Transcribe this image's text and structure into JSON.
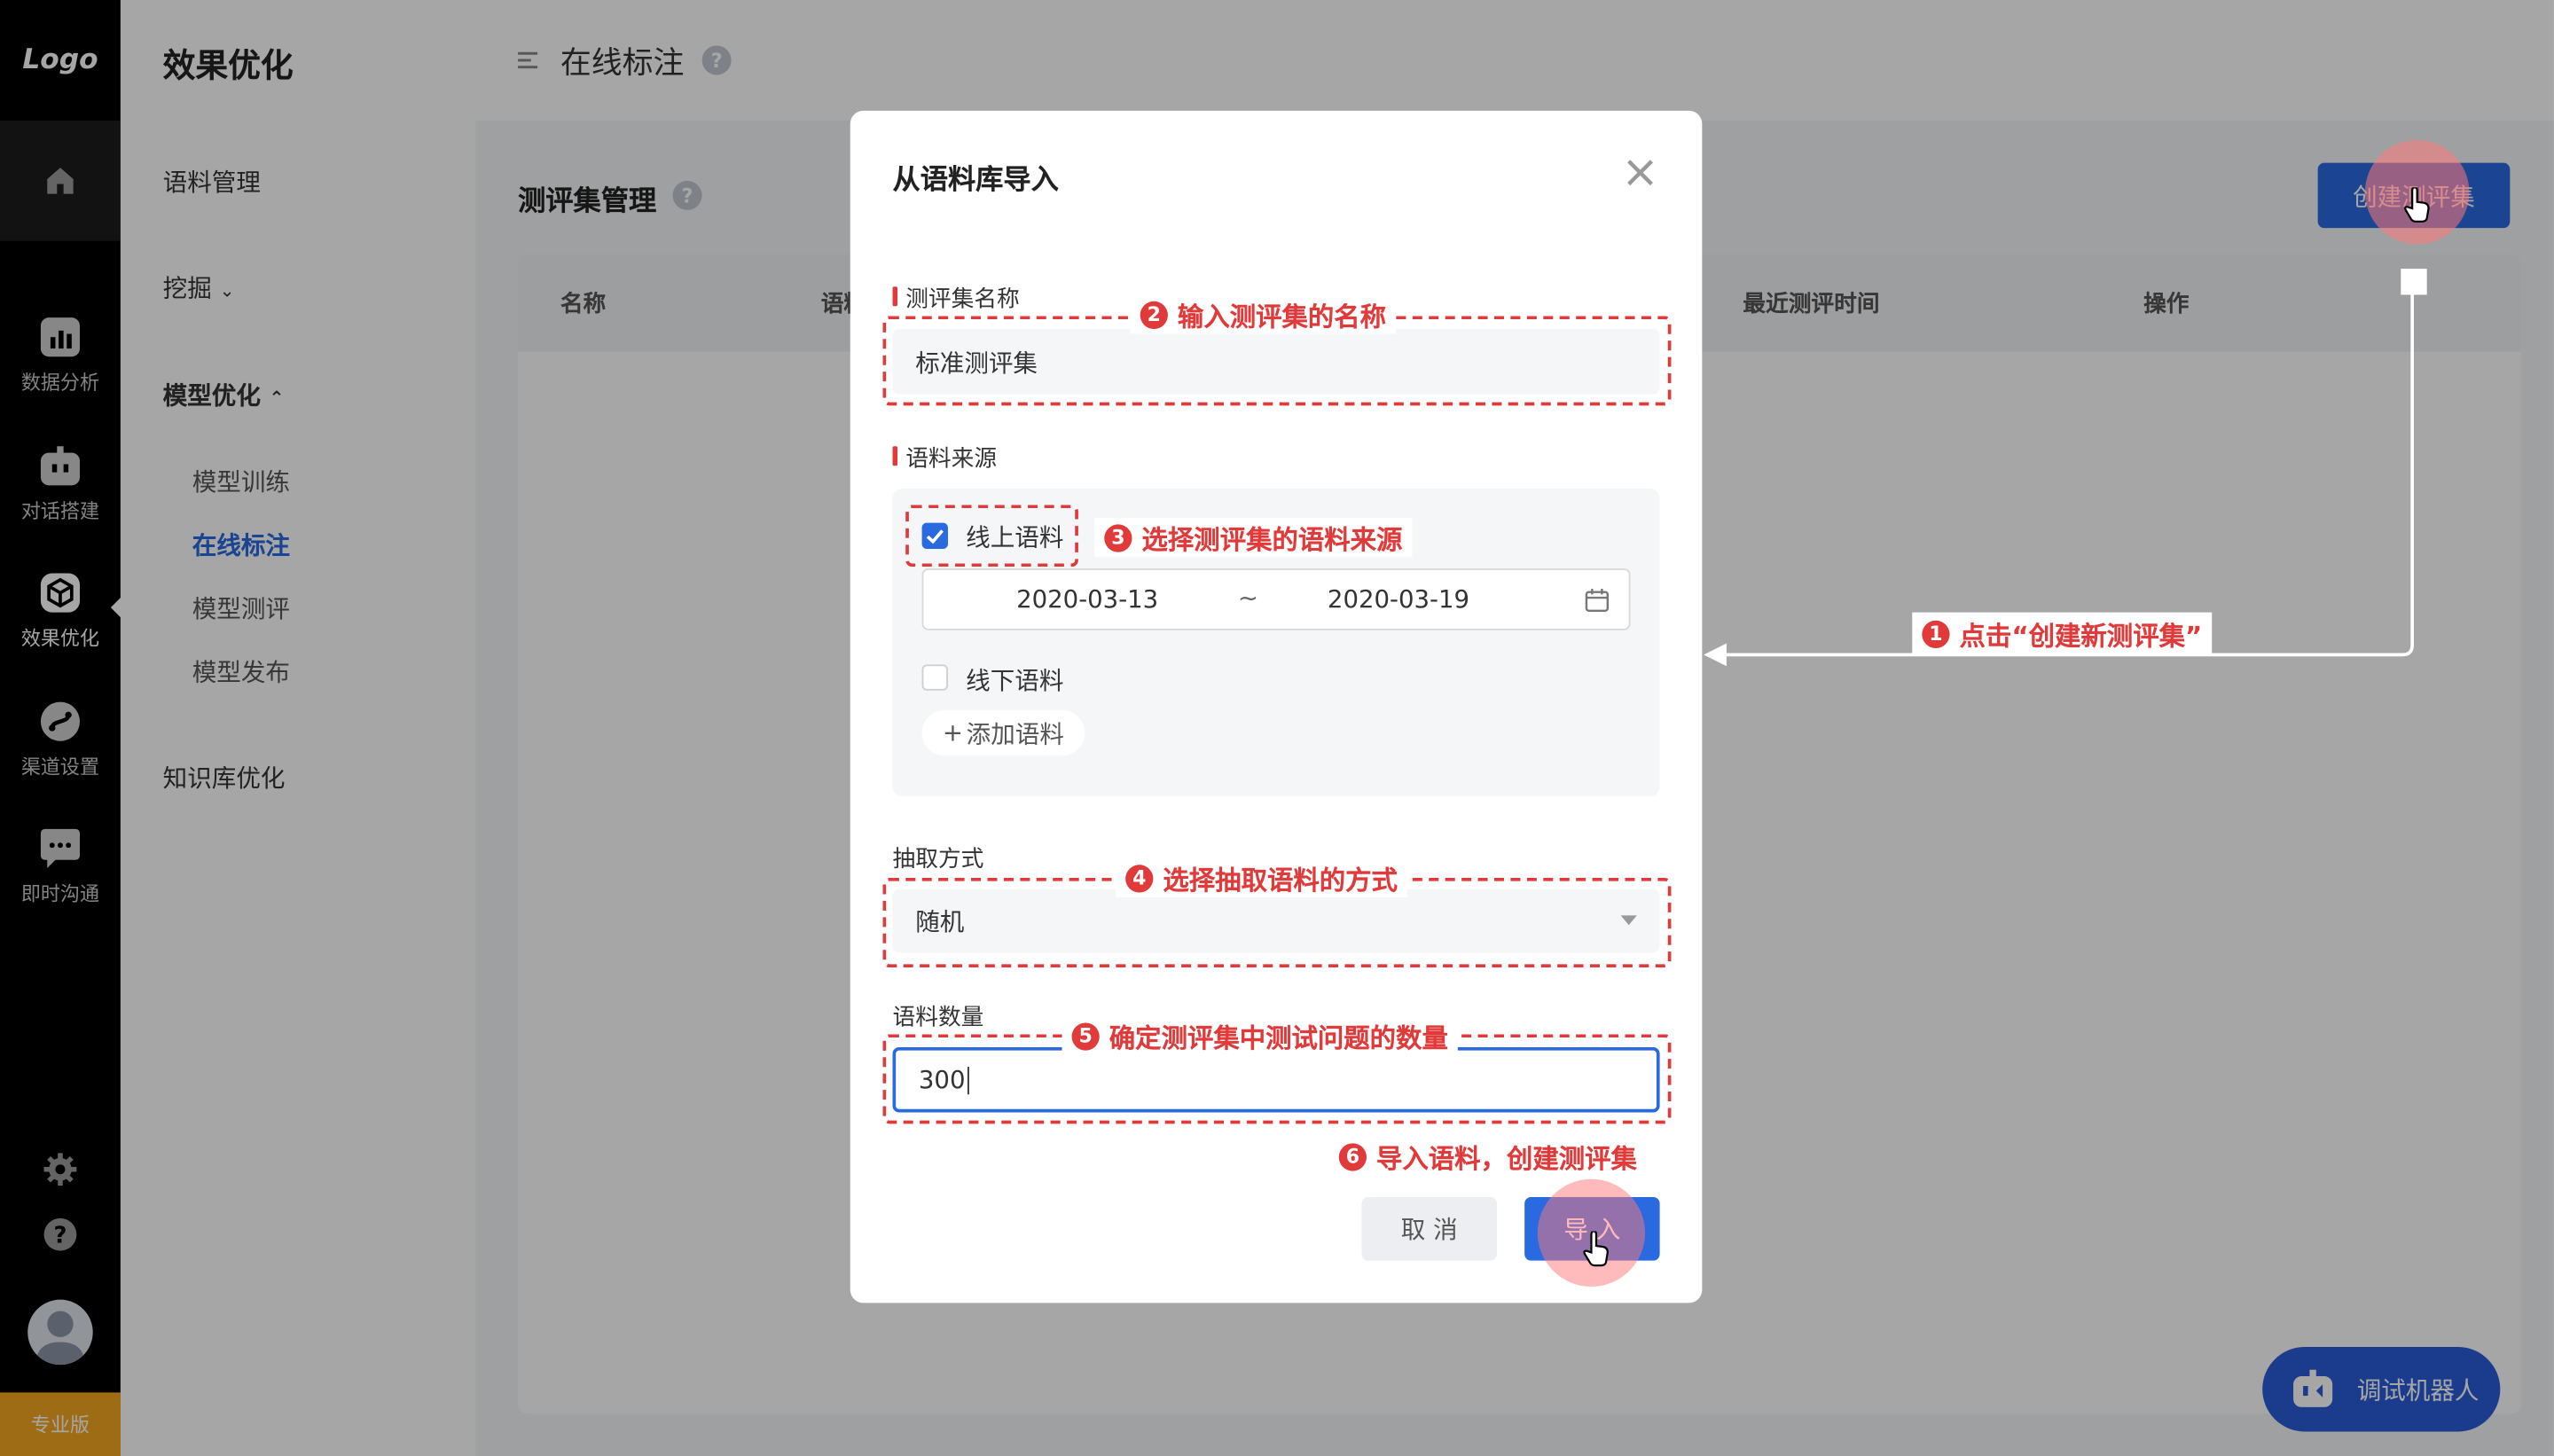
{
  "app": {
    "logo": "Logo",
    "rail": [
      {
        "label": "数据分析",
        "icon": "bar-chart-icon"
      },
      {
        "label": "对话搭建",
        "icon": "robot-icon"
      },
      {
        "label": "效果优化",
        "icon": "cube-icon"
      },
      {
        "label": "渠道设置",
        "icon": "channel-icon"
      },
      {
        "label": "即时沟通",
        "icon": "chat-icon"
      }
    ],
    "edition": "专业版"
  },
  "nav": {
    "title": "效果优化",
    "corpus": "语料管理",
    "mining": "挖掘",
    "model_opt": "模型优化",
    "sub": [
      "模型训练",
      "在线标注",
      "模型测评",
      "模型发布"
    ],
    "kb": "知识库优化"
  },
  "header": {
    "title": "在线标注"
  },
  "page": {
    "section_title": "测评集管理",
    "create_button": "创建测评集",
    "columns": [
      "名称",
      "语料",
      "最近测评时间",
      "操作"
    ]
  },
  "robot_button": "调试机器人",
  "modal": {
    "title": "从语料库导入",
    "name_label": "测评集名称",
    "name_value": "标准测评集",
    "source_label": "语料来源",
    "online_label": "线上语料",
    "online_checked": true,
    "date_start": "2020-03-13",
    "date_sep": "~",
    "date_end": "2020-03-19",
    "offline_label": "线下语料",
    "offline_checked": false,
    "add_corpus": "添加语料",
    "method_label": "抽取方式",
    "method_value": "随机",
    "count_label": "语料数量",
    "count_value": "300",
    "cancel": "取 消",
    "import": "导 入"
  },
  "annotations": [
    {
      "n": "1",
      "text": "点击“创建新测评集”"
    },
    {
      "n": "2",
      "text": "输入测评集的名称"
    },
    {
      "n": "3",
      "text": "选择测评集的语料来源"
    },
    {
      "n": "4",
      "text": "选择抽取语料的方式"
    },
    {
      "n": "5",
      "text": "确定测评集中测试问题的数量"
    },
    {
      "n": "6",
      "text": "导入语料，创建测评集"
    }
  ]
}
